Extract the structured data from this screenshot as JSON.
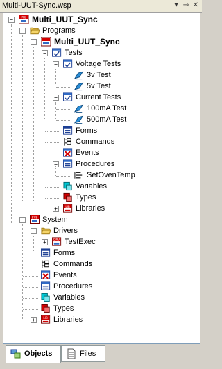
{
  "window": {
    "title": "Multi-UUT-Sync.wsp"
  },
  "tree": {
    "workspace": "Multi_UUT_Sync",
    "programs": "Programs",
    "program_name": "Multi_UUT_Sync",
    "tests": "Tests",
    "voltage_tests": "Voltage Tests",
    "test_3v": "3v Test",
    "test_5v": "5v Test",
    "current_tests": "Current Tests",
    "test_100ma": "100mA Test",
    "test_500ma": "500mA Test",
    "forms": "Forms",
    "commands": "Commands",
    "events": "Events",
    "procedures": "Procedures",
    "set_oven_temp": "SetOvenTemp",
    "variables": "Variables",
    "types": "Types",
    "libraries": "Libraries",
    "system": "System",
    "drivers": "Drivers",
    "test_exec": "TestExec",
    "sys_forms": "Forms",
    "sys_commands": "Commands",
    "sys_events": "Events",
    "sys_procedures": "Procedures",
    "sys_variables": "Variables",
    "sys_types": "Types",
    "sys_libraries": "Libraries"
  },
  "tabs": {
    "objects": "Objects",
    "files": "Files"
  },
  "icons": {
    "prj_badge": "PRJ",
    "sys_badge": "SYS",
    "drv_badge": "DRV",
    "lib_badge": "LIB"
  },
  "colors": {
    "selection": "#316ac5",
    "folder": "#f5d56a",
    "cyan": "#00c8d4",
    "red": "#d40000"
  }
}
